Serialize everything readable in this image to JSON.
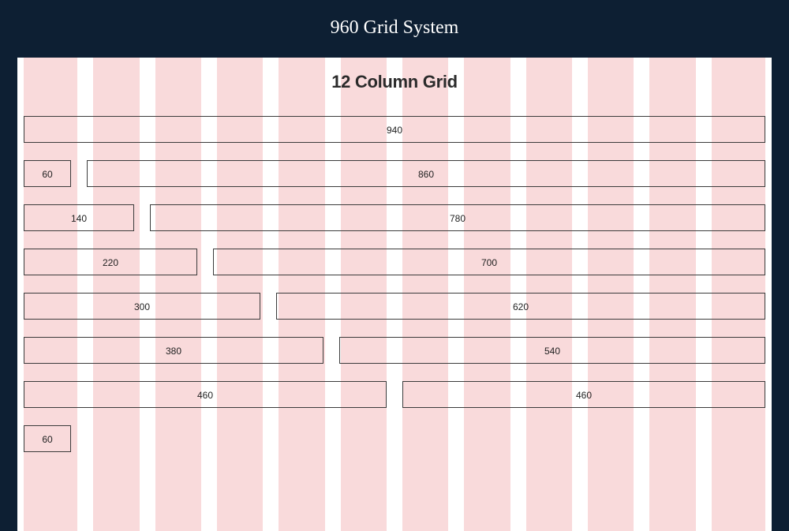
{
  "header": {
    "title": "960 Grid System"
  },
  "grid": {
    "subtitle": "12 Column Grid",
    "columns": 12,
    "rows": [
      {
        "cells": [
          {
            "cols": 12,
            "label": "940"
          }
        ]
      },
      {
        "cells": [
          {
            "cols": 1,
            "label": "60"
          },
          {
            "cols": 11,
            "label": "860"
          }
        ]
      },
      {
        "cells": [
          {
            "cols": 2,
            "label": "140"
          },
          {
            "cols": 10,
            "label": "780"
          }
        ]
      },
      {
        "cells": [
          {
            "cols": 3,
            "label": "220"
          },
          {
            "cols": 9,
            "label": "700"
          }
        ]
      },
      {
        "cells": [
          {
            "cols": 4,
            "label": "300"
          },
          {
            "cols": 8,
            "label": "620"
          }
        ]
      },
      {
        "cells": [
          {
            "cols": 5,
            "label": "380"
          },
          {
            "cols": 7,
            "label": "540"
          }
        ]
      },
      {
        "cells": [
          {
            "cols": 6,
            "label": "460"
          },
          {
            "cols": 6,
            "label": "460"
          }
        ]
      },
      {
        "cells": [
          {
            "cols": 1,
            "label": "60"
          }
        ]
      }
    ]
  }
}
